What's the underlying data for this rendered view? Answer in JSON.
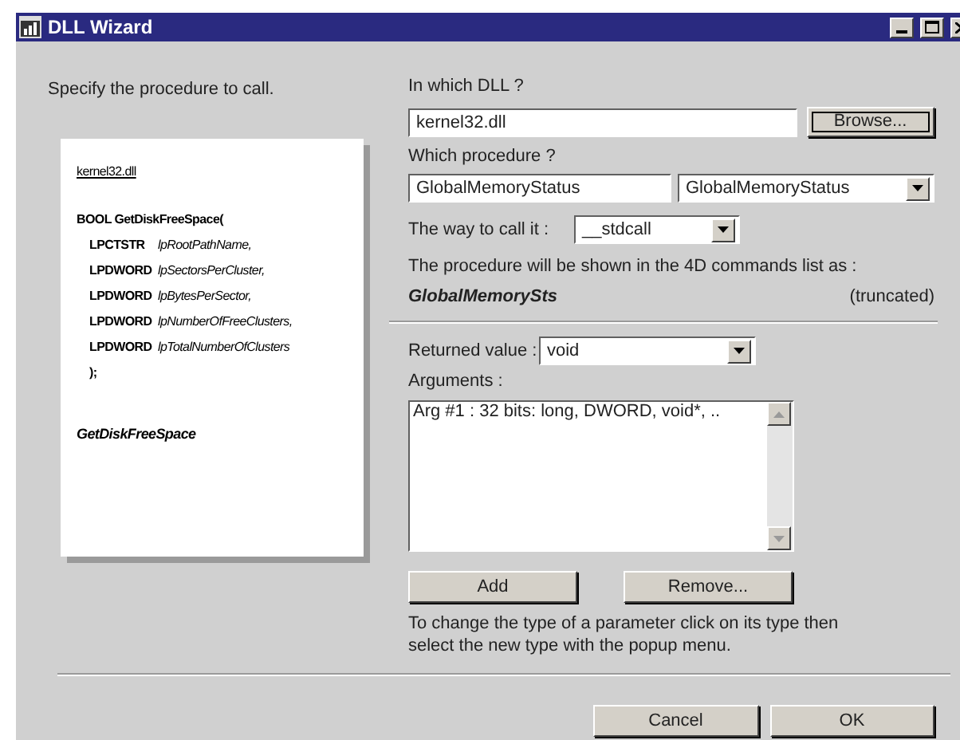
{
  "window": {
    "title": "DLL Wizard"
  },
  "instruction": "Specify the procedure to call.",
  "preview": {
    "dll": "kernel32.dll",
    "signature": "BOOL GetDiskFreeSpace(",
    "params": [
      {
        "type": "LPCTSTR",
        "name": "lpRootPathName,"
      },
      {
        "type": "LPDWORD",
        "name": "lpSectorsPerCluster,"
      },
      {
        "type": "LPDWORD",
        "name": "lpBytesPerSector,"
      },
      {
        "type": "LPDWORD",
        "name": "lpNumberOfFreeClusters,"
      },
      {
        "type": "LPDWORD",
        "name": "lpTotalNumberOfClusters"
      }
    ],
    "close": ");",
    "command": "GetDiskFreeSpace"
  },
  "dll_label": "In which DLL ?",
  "dll_value": "kernel32.dll",
  "browse_button": "Browse...",
  "procedure_label": "Which procedure ?",
  "procedure_value": "GlobalMemoryStatus",
  "procedure_select": "GlobalMemoryStatus",
  "call_label": "The way to call it :",
  "call_select": "__stdcall",
  "shown_text": "The procedure will be shown in the 4D commands list as :",
  "shown_name": "GlobalMemorySts",
  "truncated_note": "(truncated)",
  "returned_label": "Returned value :",
  "returned_select": "void",
  "arguments_label": "Arguments :",
  "arguments": [
    "Arg #1 : 32 bits: long, DWORD, void*, .."
  ],
  "add_button": "Add",
  "remove_button": "Remove...",
  "help": "To change the type of a parameter click on its type then select the new type with the popup menu.",
  "buttons": [
    "Cancel",
    "OK"
  ]
}
